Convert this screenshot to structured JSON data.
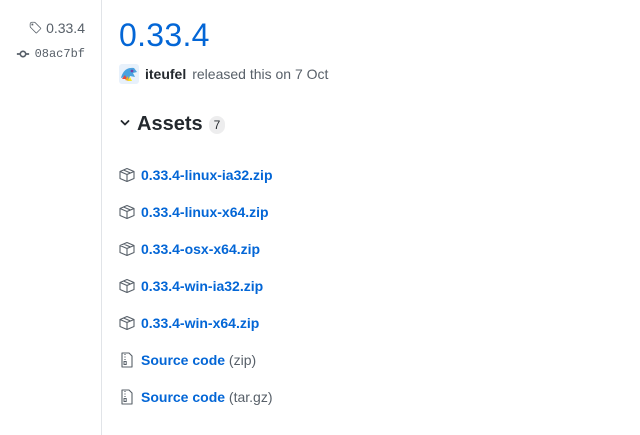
{
  "sidebar": {
    "tag": "0.33.4",
    "commit": "08ac7bf"
  },
  "release": {
    "title": "0.33.4",
    "author": "iteufel",
    "released_text": "released this on 7 Oct"
  },
  "assets": {
    "heading": "Assets",
    "count": "7",
    "items": [
      {
        "name": "0.33.4-linux-ia32.zip",
        "icon": "package-icon"
      },
      {
        "name": "0.33.4-linux-x64.zip",
        "icon": "package-icon"
      },
      {
        "name": "0.33.4-osx-x64.zip",
        "icon": "package-icon"
      },
      {
        "name": "0.33.4-win-ia32.zip",
        "icon": "package-icon"
      },
      {
        "name": "0.33.4-win-x64.zip",
        "icon": "package-icon"
      },
      {
        "name": "Source code",
        "ext": "(zip)",
        "icon": "file-zip-icon"
      },
      {
        "name": "Source code",
        "ext": "(tar.gz)",
        "icon": "file-zip-icon"
      }
    ]
  },
  "colors": {
    "link": "#0366d6",
    "muted": "#586069",
    "divider": "#e1e4e8"
  }
}
